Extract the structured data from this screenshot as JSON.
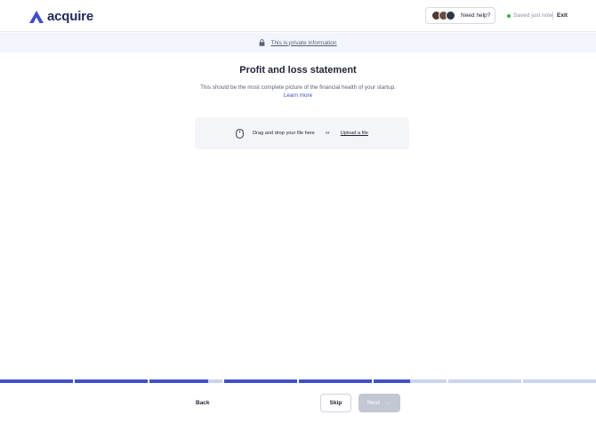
{
  "header": {
    "logo_text": "acquire",
    "help_label": "Need help?",
    "saved_text": "Saved just now",
    "exit_label": "Exit"
  },
  "privacy": {
    "text": "This is private information"
  },
  "main": {
    "title": "Profit and loss statement",
    "subtitle": "This should be the most complete picture of the financial health of your startup.",
    "learn_more": "Learn more",
    "dropzone": {
      "drag_text": "Drag and drop your file here",
      "or_text": "or",
      "upload_link": "Upload a file"
    }
  },
  "progress": {
    "segments": [
      1,
      1,
      0.8,
      1,
      1,
      0.5,
      0,
      0
    ]
  },
  "footer": {
    "back_label": "Back",
    "skip_label": "Skip",
    "next_label": "Next",
    "next_arrow": "→"
  },
  "colors": {
    "brand": "#3f4ec9",
    "progress_fill": "#4150cf",
    "progress_track": "#c9d4ef",
    "saved_dot": "#2bb24c",
    "disabled_button": "#c3c6d3"
  },
  "icons": {
    "logo": "acquire-logo-icon",
    "lock": "lock-icon",
    "mouse": "mouse-icon",
    "arrow": "arrow-right-icon"
  }
}
